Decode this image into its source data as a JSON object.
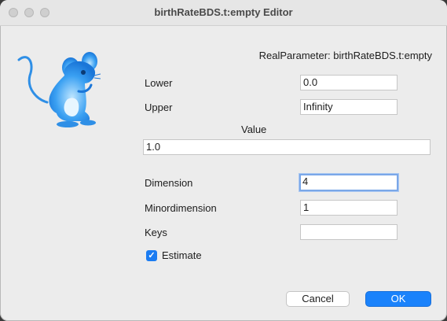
{
  "window": {
    "title": "birthRateBDS.t:empty Editor"
  },
  "header": {
    "param_label": "RealParameter: birthRateBDS.t:empty"
  },
  "fields": {
    "lower_label": "Lower",
    "lower_value": "0.0",
    "upper_label": "Upper",
    "upper_value": "Infinity",
    "value_label": "Value",
    "value_value": "1.0",
    "dimension_label": "Dimension",
    "dimension_value": "4",
    "minordimension_label": "Minordimension",
    "minordimension_value": "1",
    "keys_label": "Keys",
    "keys_value": ""
  },
  "estimate": {
    "label": "Estimate",
    "checked": true
  },
  "buttons": {
    "cancel": "Cancel",
    "ok": "OK"
  },
  "icons": {
    "logo": "beast-mouse-logo-icon",
    "check": "checkmark-icon"
  },
  "colors": {
    "accent": "#1a82fb",
    "logo": "#3a9ff2"
  }
}
